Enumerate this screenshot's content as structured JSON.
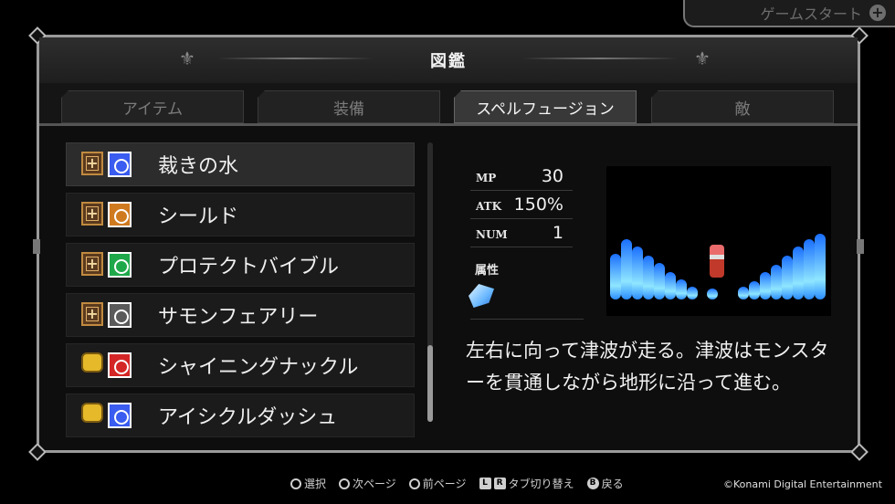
{
  "header_tab": {
    "label": "ゲームスタート",
    "icon": "plus-icon"
  },
  "title": "図鑑",
  "tabs": [
    {
      "label": "アイテム",
      "active": false
    },
    {
      "label": "装備",
      "active": false
    },
    {
      "label": "スペルフュージョン",
      "active": true
    },
    {
      "label": "敵",
      "active": false
    }
  ],
  "list": [
    {
      "label": "裁きの水",
      "icon1": "cross-book-icon",
      "icon2": "blue-spell-icon",
      "icon2_color": "#3a5cf0",
      "selected": true
    },
    {
      "label": "シールド",
      "icon1": "cross-book-icon",
      "icon2": "orange-spell-icon",
      "icon2_color": "#d07a20",
      "selected": false
    },
    {
      "label": "プロテクトバイブル",
      "icon1": "cross-book-icon",
      "icon2": "green-spell-icon",
      "icon2_color": "#1fa84a",
      "selected": false
    },
    {
      "label": "サモンフェアリー",
      "icon1": "cross-book-icon",
      "icon2": "gray-spell-icon",
      "icon2_color": "#5a5a5a",
      "selected": false
    },
    {
      "label": "シャイニングナックル",
      "icon1": "fist-icon",
      "icon2": "red-spell-icon",
      "icon2_color": "#d42626",
      "selected": false
    },
    {
      "label": "アイシクルダッシュ",
      "icon1": "fist-icon",
      "icon2": "blue-spell-icon",
      "icon2_color": "#3a5cf0",
      "selected": false
    }
  ],
  "stats": [
    {
      "key": "MP",
      "value": "30"
    },
    {
      "key": "ATK",
      "value": "150%"
    },
    {
      "key": "NUM",
      "value": "1"
    }
  ],
  "attribute": {
    "label": "属性",
    "icon": "ice-crystal-icon"
  },
  "description": "左右に向って津波が走る。津波はモンスターを貫通しながら地形に沿って進む。",
  "footer": [
    {
      "key": "ring",
      "label": "選択"
    },
    {
      "key": "ring",
      "label": "次ページ"
    },
    {
      "key": "ring",
      "label": "前ページ"
    },
    {
      "key": "L R",
      "label": "タブ切り替え"
    },
    {
      "key": "B",
      "label": "戻る"
    }
  ],
  "copyright": "©Konami Digital Entertainment"
}
